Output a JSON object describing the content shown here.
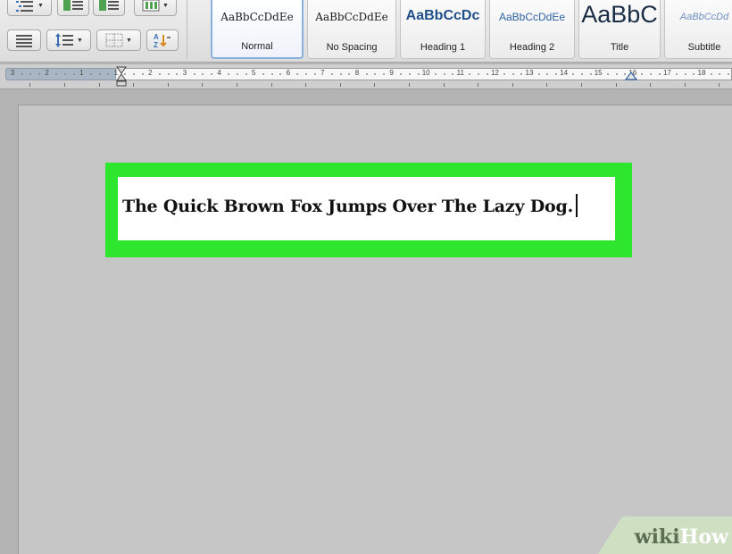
{
  "ribbon": {
    "styles": [
      {
        "sample": "AaBbCcDdEe",
        "label": "Normal"
      },
      {
        "sample": "AaBbCcDdEe",
        "label": "No Spacing"
      },
      {
        "sample": "AaBbCcDc",
        "label": "Heading 1"
      },
      {
        "sample": "AaBbCcDdEe",
        "label": "Heading 2"
      },
      {
        "sample": "AaBbC",
        "label": "Title"
      },
      {
        "sample": "AaBbCcDd",
        "label": "Subtitle"
      }
    ],
    "selected_style": "Normal"
  },
  "ruler": {
    "labels": [
      "3",
      "2",
      "1",
      "1",
      "2",
      "3",
      "4",
      "5",
      "6",
      "7",
      "8",
      "9",
      "10",
      "11",
      "12",
      "13",
      "14",
      "15",
      "16",
      "17",
      "18"
    ]
  },
  "document": {
    "text": "The Quick Brown Fox Jumps Over The Lazy Dog.",
    "highlight_color": "#2ee62e"
  },
  "watermark": {
    "part1": "wiki",
    "part2": "How"
  }
}
